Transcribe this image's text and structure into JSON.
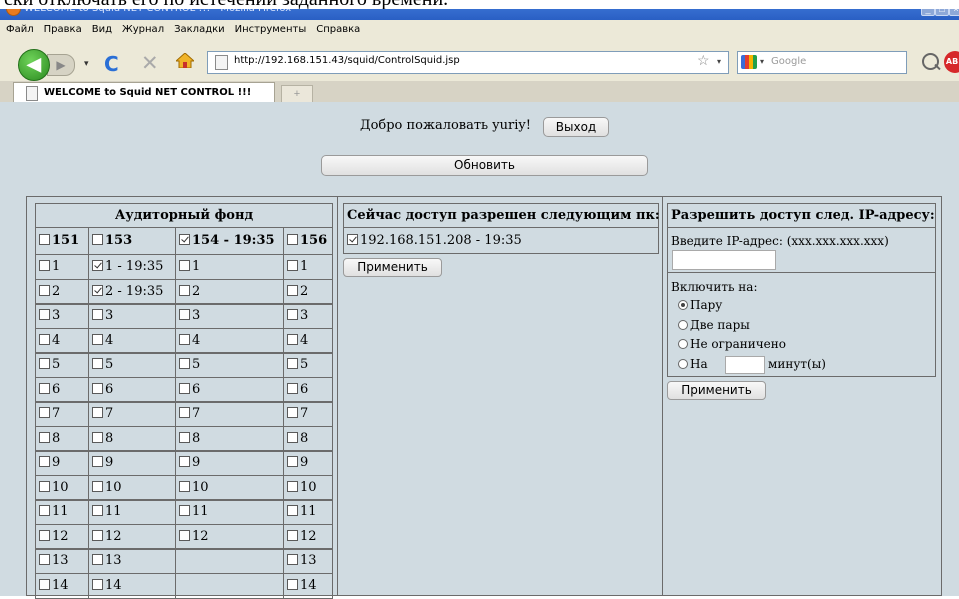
{
  "top_caption": "ски отключать его по истечении заданного времени.",
  "window": {
    "title": "WELCOME to Squid NET CONTROL !!! - Mozilla Firefox",
    "buttons": [
      "_",
      "□",
      "×"
    ]
  },
  "menu": [
    "Файл",
    "Правка",
    "Вид",
    "Журнал",
    "Закладки",
    "Инструменты",
    "Справка"
  ],
  "nav": {
    "url": "http://192.168.151.43/squid/ControlSquid.jsp",
    "search_placeholder": "Google",
    "back_icon": "◀",
    "forward_icon": "▶",
    "reload_icon": "C",
    "stop_icon": "✕",
    "star_icon": "☆",
    "dropdown_icon": "▾",
    "abp_label": "ABP"
  },
  "tabs": [
    {
      "label": "WELCOME to Squid NET CONTROL !!!"
    }
  ],
  "new_tab_label": "+",
  "welcome": {
    "text": "Добро пожаловать yuriy!",
    "logout_label": "Выход",
    "refresh_label": "Обновить"
  },
  "auditorium": {
    "title": "Аудиторный фонд",
    "columns": [
      {
        "label": "151",
        "checked": false
      },
      {
        "label": "153",
        "checked": false
      },
      {
        "label": "154 - 19:35",
        "checked": true
      },
      {
        "label": "156",
        "checked": false
      }
    ],
    "rows": [
      [
        {
          "label": "1",
          "checked": false
        },
        {
          "label": "1 - 19:35",
          "checked": true
        },
        {
          "label": "1",
          "checked": false
        },
        {
          "label": "1",
          "checked": false
        }
      ],
      [
        {
          "label": "2",
          "checked": false
        },
        {
          "label": "2 - 19:35",
          "checked": true
        },
        {
          "label": "2",
          "checked": false
        },
        {
          "label": "2",
          "checked": false
        }
      ],
      [
        {
          "label": "3",
          "checked": false
        },
        {
          "label": "3",
          "checked": false
        },
        {
          "label": "3",
          "checked": false
        },
        {
          "label": "3",
          "checked": false
        }
      ],
      [
        {
          "label": "4",
          "checked": false
        },
        {
          "label": "4",
          "checked": false
        },
        {
          "label": "4",
          "checked": false
        },
        {
          "label": "4",
          "checked": false
        }
      ],
      [
        {
          "label": "5",
          "checked": false
        },
        {
          "label": "5",
          "checked": false
        },
        {
          "label": "5",
          "checked": false
        },
        {
          "label": "5",
          "checked": false
        }
      ],
      [
        {
          "label": "6",
          "checked": false
        },
        {
          "label": "6",
          "checked": false
        },
        {
          "label": "6",
          "checked": false
        },
        {
          "label": "6",
          "checked": false
        }
      ],
      [
        {
          "label": "7",
          "checked": false
        },
        {
          "label": "7",
          "checked": false
        },
        {
          "label": "7",
          "checked": false
        },
        {
          "label": "7",
          "checked": false
        }
      ],
      [
        {
          "label": "8",
          "checked": false
        },
        {
          "label": "8",
          "checked": false
        },
        {
          "label": "8",
          "checked": false
        },
        {
          "label": "8",
          "checked": false
        }
      ],
      [
        {
          "label": "9",
          "checked": false
        },
        {
          "label": "9",
          "checked": false
        },
        {
          "label": "9",
          "checked": false
        },
        {
          "label": "9",
          "checked": false
        }
      ],
      [
        {
          "label": "10",
          "checked": false
        },
        {
          "label": "10",
          "checked": false
        },
        {
          "label": "10",
          "checked": false
        },
        {
          "label": "10",
          "checked": false
        }
      ],
      [
        {
          "label": "11",
          "checked": false
        },
        {
          "label": "11",
          "checked": false
        },
        {
          "label": "11",
          "checked": false
        },
        {
          "label": "11",
          "checked": false
        }
      ],
      [
        {
          "label": "12",
          "checked": false
        },
        {
          "label": "12",
          "checked": false
        },
        {
          "label": "12",
          "checked": false
        },
        {
          "label": "12",
          "checked": false
        }
      ],
      [
        {
          "label": "13",
          "checked": false
        },
        {
          "label": "13",
          "checked": false
        },
        null,
        {
          "label": "13",
          "checked": false
        }
      ],
      [
        {
          "label": "14",
          "checked": false
        },
        {
          "label": "14",
          "checked": false
        },
        null,
        {
          "label": "14",
          "checked": false
        }
      ]
    ]
  },
  "allowed": {
    "title": "Сейчас доступ разрешен следующим пк:",
    "items": [
      {
        "label": "192.168.151.208 - 19:35",
        "checked": true
      }
    ],
    "apply_label": "Применить"
  },
  "grant": {
    "title": "Разрешить доступ след. IP-адресу:",
    "ip_label": "Введите IP-адрес: (xxx.xxx.xxx.xxx)",
    "ip_value": "",
    "enable_label": "Включить на:",
    "options": [
      {
        "label": "Пару",
        "selected": true
      },
      {
        "label": "Две пары",
        "selected": false
      },
      {
        "label": "Не ограничено",
        "selected": false
      },
      {
        "label": "На",
        "selected": false
      }
    ],
    "minutes_suffix": "минут(ы)",
    "minutes_value": "",
    "apply_label": "Применить"
  }
}
